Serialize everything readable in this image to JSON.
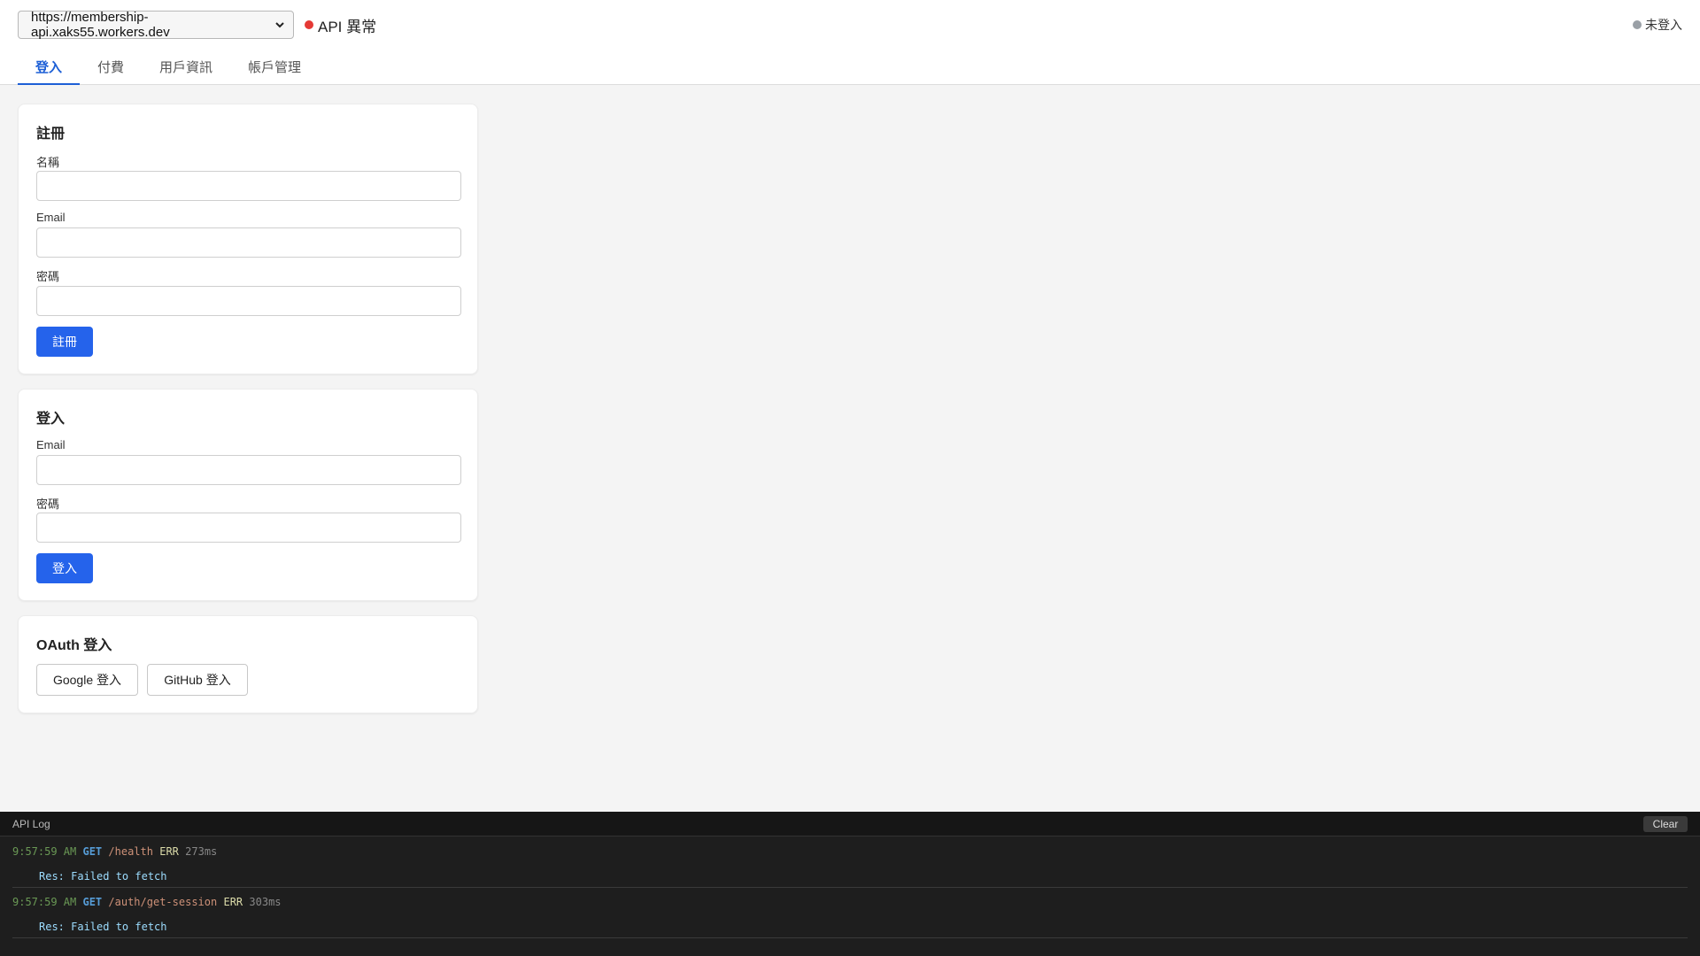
{
  "header": {
    "endpoint_select": {
      "selected": "https://membership-api.xaks55.workers.dev"
    },
    "api_status": {
      "label": "API 異常",
      "color": "#e53935"
    },
    "login_status": {
      "label": "未登入",
      "color": "#9aa0a6"
    },
    "tabs": [
      {
        "label": "登入",
        "active": true
      },
      {
        "label": "付費",
        "active": false
      },
      {
        "label": "用戶資訊",
        "active": false
      },
      {
        "label": "帳戶管理",
        "active": false
      }
    ]
  },
  "register": {
    "title": "註冊",
    "name_label": "名稱",
    "email_label": "Email",
    "password_label": "密碼",
    "name_value": "",
    "email_value": "",
    "password_value": "",
    "submit_label": "註冊"
  },
  "login": {
    "title": "登入",
    "email_label": "Email",
    "password_label": "密碼",
    "email_value": "",
    "password_value": "",
    "submit_label": "登入"
  },
  "oauth": {
    "title": "OAuth 登入",
    "google_label": "Google 登入",
    "github_label": "GitHub 登入"
  },
  "api_log": {
    "title": "API Log",
    "clear_label": "Clear",
    "entries": [
      {
        "time": "9:57:59 AM",
        "method": "GET",
        "path": "/health",
        "status": "ERR",
        "duration": "273ms",
        "response": "Res: Failed to fetch"
      },
      {
        "time": "9:57:59 AM",
        "method": "GET",
        "path": "/auth/get-session",
        "status": "ERR",
        "duration": "303ms",
        "response": "Res: Failed to fetch"
      }
    ]
  },
  "colors": {
    "accent": "#2563eb",
    "tab_active": "#1d5fd6",
    "error_dot": "#e53935"
  }
}
